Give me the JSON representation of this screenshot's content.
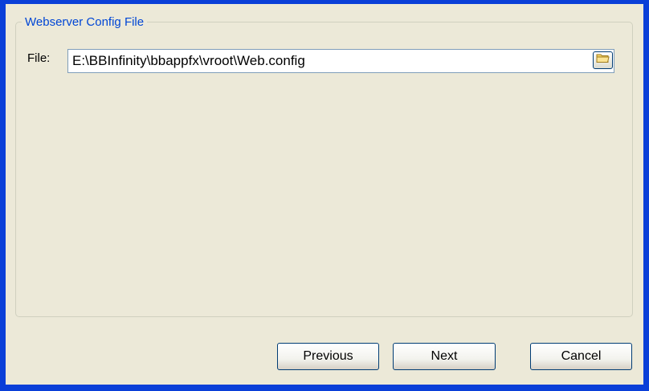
{
  "group": {
    "title": "Webserver Config File"
  },
  "file": {
    "label": "File:",
    "value": "E:\\BBInfinity\\bbappfx\\vroot\\Web.config",
    "browse_icon": "folder-icon"
  },
  "buttons": {
    "previous": "Previous",
    "next": "Next",
    "cancel": "Cancel"
  },
  "colors": {
    "window_border": "#0a3fd8",
    "background": "#ece9d8",
    "legend_text": "#0046d5"
  }
}
